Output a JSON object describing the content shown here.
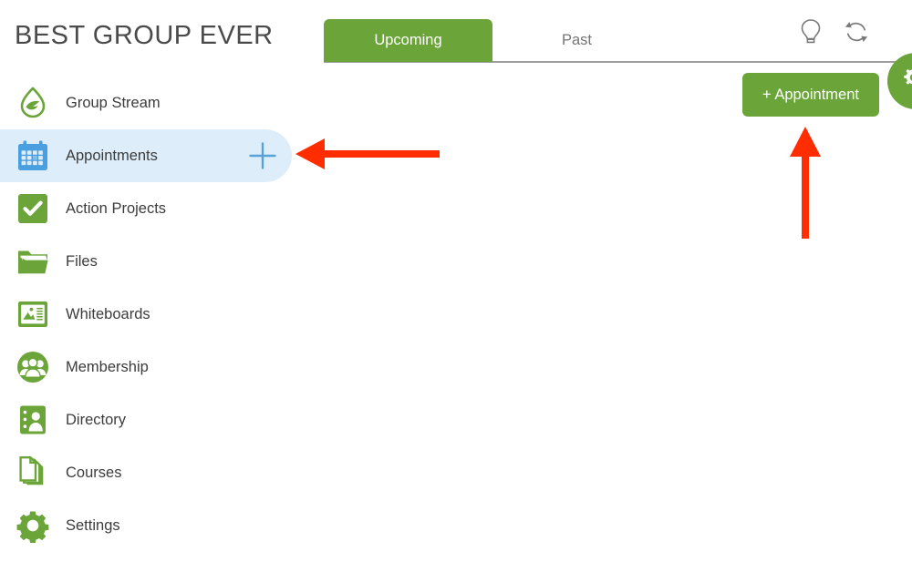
{
  "header": {
    "group_title": "BEST GROUP EVER"
  },
  "tabs": [
    {
      "label": "Upcoming",
      "active": true,
      "name": "tab-upcoming"
    },
    {
      "label": "Past",
      "active": false,
      "name": "tab-past"
    }
  ],
  "topbar": {
    "icons": [
      {
        "name": "lightbulb-icon",
        "label": "Tips"
      },
      {
        "name": "refresh-icon",
        "label": "Refresh"
      }
    ],
    "avatar": {
      "name": "gear-avatar-icon",
      "label": "Settings"
    }
  },
  "actions": {
    "add_appointment_label": "+ Appointment"
  },
  "sidebar": {
    "items": [
      {
        "label": "Group Stream",
        "icon": "leaf-drop-icon",
        "name": "sidebar-item-group-stream",
        "selected": false,
        "has_plus": false
      },
      {
        "label": "Appointments",
        "icon": "calendar-icon",
        "name": "sidebar-item-appointments",
        "selected": true,
        "has_plus": true
      },
      {
        "label": "Action Projects",
        "icon": "checkmark-icon",
        "name": "sidebar-item-action-projects",
        "selected": false,
        "has_plus": false
      },
      {
        "label": "Files",
        "icon": "folder-icon",
        "name": "sidebar-item-files",
        "selected": false,
        "has_plus": false
      },
      {
        "label": "Whiteboards",
        "icon": "whiteboard-icon",
        "name": "sidebar-item-whiteboards",
        "selected": false,
        "has_plus": false
      },
      {
        "label": "Membership",
        "icon": "people-group-icon",
        "name": "sidebar-item-membership",
        "selected": false,
        "has_plus": false
      },
      {
        "label": "Directory",
        "icon": "contact-card-icon",
        "name": "sidebar-item-directory",
        "selected": false,
        "has_plus": false
      },
      {
        "label": "Courses",
        "icon": "documents-icon",
        "name": "sidebar-item-courses",
        "selected": false,
        "has_plus": false
      },
      {
        "label": "Settings",
        "icon": "gear-icon",
        "name": "sidebar-item-settings",
        "selected": false,
        "has_plus": false
      }
    ],
    "plus_icon_name": "plus-icon"
  },
  "annotations": [
    {
      "name": "arrow-pointing-to-appointments-plus",
      "direction": "left",
      "color": "#FF2D00"
    },
    {
      "name": "arrow-pointing-to-add-appointment-button",
      "direction": "up",
      "color": "#FF2D00"
    }
  ],
  "colors": {
    "brand_green": "#6ba539",
    "selected_blue_bg": "#ddeefa",
    "calendar_blue": "#4a9fe0",
    "annotation_red": "#FF2D00",
    "text_dark": "#3c3c3c",
    "text_muted": "#757575"
  }
}
